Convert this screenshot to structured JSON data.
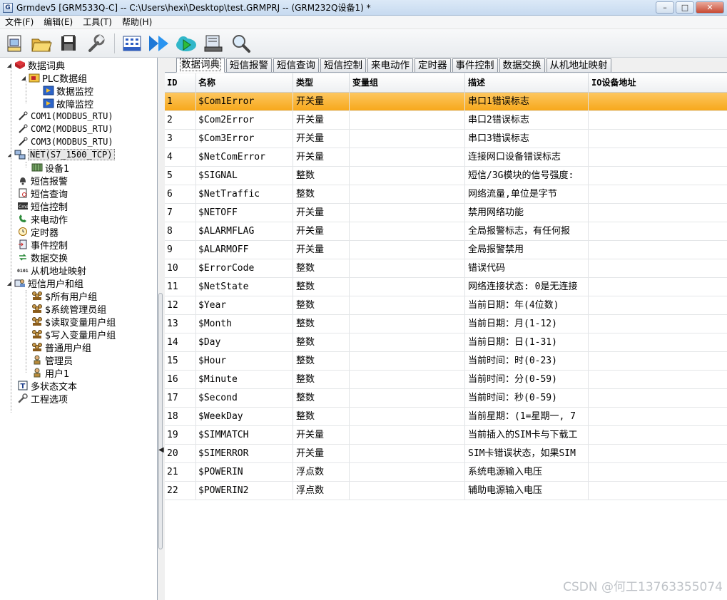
{
  "window": {
    "title": "Grmdev5 [GRM533Q-C]  -- C:\\Users\\hexi\\Desktop\\test.GRMPRJ -- (GRM232Q设备1) *",
    "app_icon": "G"
  },
  "menu": [
    "文件(F)",
    "编辑(E)",
    "工具(T)",
    "帮助(H)"
  ],
  "toolbar": [
    "new-project-icon",
    "open-folder-icon",
    "save-icon",
    "settings-wrench-icon",
    "grid-monitor-icon",
    "download-arrows-icon",
    "cloud-sync-icon",
    "device-config-icon",
    "search-icon"
  ],
  "tree": {
    "items": [
      {
        "label": "数据词典",
        "icon": "book-icon"
      },
      {
        "label": "PLC数据组",
        "icon": "folder-icon"
      },
      {
        "label": "数据监控",
        "icon": "monitor-icon"
      },
      {
        "label": "故障监控",
        "icon": "monitor-icon"
      },
      {
        "label": "COM1(MODBUS_RTU)",
        "icon": "port-icon"
      },
      {
        "label": "COM2(MODBUS_RTU)",
        "icon": "port-icon"
      },
      {
        "label": "COM3(MODBUS_RTU)",
        "icon": "port-icon"
      },
      {
        "label": "NET(S7_1500_TCP)",
        "icon": "network-icon"
      },
      {
        "label": "设备1",
        "icon": "device-icon"
      },
      {
        "label": "短信报警",
        "icon": "bell-icon"
      },
      {
        "label": "短信查询",
        "icon": "query-icon"
      },
      {
        "label": "短信控制",
        "icon": "cmd-icon"
      },
      {
        "label": "来电动作",
        "icon": "phone-icon"
      },
      {
        "label": "定时器",
        "icon": "timer-icon"
      },
      {
        "label": "事件控制",
        "icon": "event-icon"
      },
      {
        "label": "数据交换",
        "icon": "exchange-icon"
      },
      {
        "label": "从机地址映射",
        "icon": "binary-icon"
      },
      {
        "label": "短信用户和组",
        "icon": "users-icon"
      },
      {
        "label": "$所有用户组",
        "icon": "group-icon"
      },
      {
        "label": "$系统管理员组",
        "icon": "group-icon"
      },
      {
        "label": "$读取变量用户组",
        "icon": "group-icon"
      },
      {
        "label": "$写入变量用户组",
        "icon": "group-icon"
      },
      {
        "label": "普通用户组",
        "icon": "group-icon"
      },
      {
        "label": "管理员",
        "icon": "user-icon"
      },
      {
        "label": "用户1",
        "icon": "user-icon"
      },
      {
        "label": "多状态文本",
        "icon": "text-icon"
      },
      {
        "label": "工程选项",
        "icon": "wrench-icon"
      }
    ]
  },
  "tabs": [
    "数据词典",
    "短信报警",
    "短信查询",
    "短信控制",
    "来电动作",
    "定时器",
    "事件控制",
    "数据交换",
    "从机地址映射"
  ],
  "grid": {
    "headers": [
      "ID",
      "名称",
      "类型",
      "变量组",
      "描述",
      "IO设备地址"
    ],
    "rows": [
      [
        "1",
        "$Com1Error",
        "开关量",
        "",
        "串口1错误标志",
        ""
      ],
      [
        "2",
        "$Com2Error",
        "开关量",
        "",
        "串口2错误标志",
        ""
      ],
      [
        "3",
        "$Com3Error",
        "开关量",
        "",
        "串口3错误标志",
        ""
      ],
      [
        "4",
        "$NetComError",
        "开关量",
        "",
        "连接网口设备错误标志",
        ""
      ],
      [
        "5",
        "$SIGNAL",
        "整数",
        "",
        "短信/3G模块的信号强度:",
        ""
      ],
      [
        "6",
        "$NetTraffic",
        "整数",
        "",
        "网络流量,单位是字节",
        ""
      ],
      [
        "7",
        "$NETOFF",
        "开关量",
        "",
        "禁用网络功能",
        ""
      ],
      [
        "8",
        "$ALARMFLAG",
        "开关量",
        "",
        "全局报警标志，有任何报",
        ""
      ],
      [
        "9",
        "$ALARMOFF",
        "开关量",
        "",
        "全局报警禁用",
        ""
      ],
      [
        "10",
        "$ErrorCode",
        "整数",
        "",
        "错误代码",
        ""
      ],
      [
        "11",
        "$NetState",
        "整数",
        "",
        "网络连接状态: 0是无连接",
        ""
      ],
      [
        "12",
        "$Year",
        "整数",
        "",
        "当前日期：年(4位数)",
        ""
      ],
      [
        "13",
        "$Month",
        "整数",
        "",
        "当前日期：月(1-12)",
        ""
      ],
      [
        "14",
        "$Day",
        "整数",
        "",
        "当前日期：日(1-31)",
        ""
      ],
      [
        "15",
        "$Hour",
        "整数",
        "",
        "当前时间：时(0-23)",
        ""
      ],
      [
        "16",
        "$Minute",
        "整数",
        "",
        "当前时间：分(0-59)",
        ""
      ],
      [
        "17",
        "$Second",
        "整数",
        "",
        "当前时间：秒(0-59)",
        ""
      ],
      [
        "18",
        "$WeekDay",
        "整数",
        "",
        "当前星期：(1=星期一, 7",
        ""
      ],
      [
        "19",
        "$SIMMATCH",
        "开关量",
        "",
        "当前插入的SIM卡与下载工",
        ""
      ],
      [
        "20",
        "$SIMERROR",
        "开关量",
        "",
        "SIM卡错误状态，如果SIM",
        ""
      ],
      [
        "21",
        "$POWERIN",
        "浮点数",
        "",
        "系统电源输入电压",
        ""
      ],
      [
        "22",
        "$POWERIN2",
        "浮点数",
        "",
        "辅助电源输入电压",
        ""
      ]
    ]
  },
  "watermark": "CSDN @何工13763355074"
}
